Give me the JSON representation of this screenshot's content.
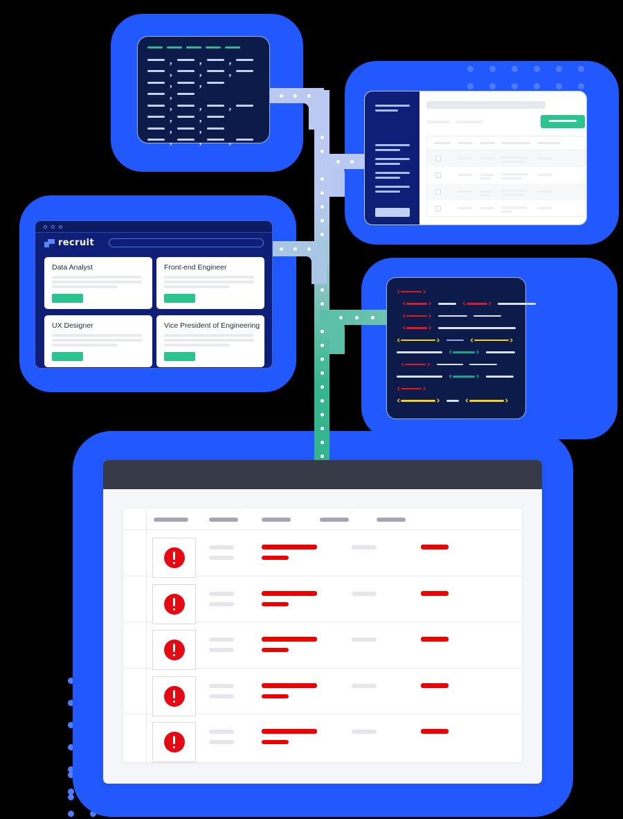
{
  "illustration": {
    "title": "Recruiting data pipeline illustration",
    "colors": {
      "plate_blue": "#2259ff",
      "dark_navy": "#0d1b4b",
      "sidebar_navy": "#0f1f78",
      "accent_green": "#2bc48f",
      "alert_red": "#e50914",
      "code_red": "#e01b24",
      "code_yellow": "#f2d024",
      "code_teal": "#17a98a",
      "pipe_light": "#b9c9f2",
      "pipe_green": "#35b58f",
      "titlebar_dark": "#373a47",
      "page_bg": "#000000"
    }
  },
  "csv_panel": {
    "name": "CSV data source",
    "header_segments": 5,
    "rows": [
      {
        "segments": 4
      },
      {
        "segments": 4
      },
      {
        "segments": 3
      },
      {
        "segments": 2
      },
      {
        "segments": 4
      },
      {
        "segments": 3
      },
      {
        "segments": 3
      },
      {
        "segments": 4
      }
    ],
    "separator": ","
  },
  "dashboard_panel": {
    "name": "ATS dashboard",
    "sidebar": {
      "brand_lines": 2,
      "nav_items": 5,
      "footer_chip": true
    },
    "main": {
      "page_title_placeholder": true,
      "filter_placeholders": 2,
      "primary_button": {
        "label": "",
        "color": "#2bc48f"
      },
      "table": {
        "column_count": 5,
        "row_count": 4,
        "has_checkboxes": true
      }
    }
  },
  "recruit_panel": {
    "name": "recruit job board",
    "window_dots": 3,
    "brand": "recruit",
    "search": {
      "placeholder": "",
      "value": ""
    },
    "jobs": [
      {
        "title": "Data Analyst",
        "desc_lines": 3,
        "action_label": ""
      },
      {
        "title": "Front-end Engineer",
        "desc_lines": 3,
        "action_label": ""
      },
      {
        "title": "UX Designer",
        "desc_lines": 3,
        "action_label": ""
      },
      {
        "title": "Vice President of Engineering",
        "desc_lines": 3,
        "action_label": ""
      }
    ]
  },
  "code_panel": {
    "name": "HTML markup source",
    "rows": [
      {
        "tokens": [
          {
            "type": "tag",
            "color": "red",
            "w": 30
          }
        ]
      },
      {
        "tokens": [
          {
            "type": "tag",
            "color": "red",
            "w": 30,
            "indent": 8
          },
          {
            "type": "text",
            "w": 26
          },
          {
            "type": "tag",
            "color": "red",
            "w": 30
          },
          {
            "type": "text",
            "w": 55
          }
        ]
      },
      {
        "tokens": [
          {
            "type": "tag",
            "color": "red",
            "w": 30,
            "indent": 8
          },
          {
            "type": "text",
            "w": 42
          },
          {
            "type": "text",
            "w": 40
          }
        ]
      },
      {
        "tokens": [
          {
            "type": "tag",
            "color": "red",
            "w": 30,
            "indent": 8
          },
          {
            "type": "text",
            "w": 112
          }
        ]
      },
      {
        "tokens": [
          {
            "type": "tag",
            "color": "yellow",
            "w": 50
          },
          {
            "type": "text",
            "w": 25,
            "tint": "blue"
          },
          {
            "type": "tag",
            "color": "yellow",
            "w": 50
          }
        ]
      },
      {
        "tokens": [
          {
            "type": "text",
            "w": 66
          },
          {
            "type": "tag",
            "color": "teal",
            "w": 32
          },
          {
            "type": "text",
            "w": 42
          }
        ]
      },
      {
        "tokens": [
          {
            "type": "tag",
            "color": "red",
            "w": 30,
            "indent": 6
          },
          {
            "type": "text",
            "w": 38
          },
          {
            "type": "text",
            "w": 40
          }
        ]
      },
      {
        "tokens": [
          {
            "type": "text",
            "w": 66
          },
          {
            "type": "tag",
            "color": "teal",
            "w": 32
          },
          {
            "type": "text",
            "w": 40
          }
        ]
      },
      {
        "tokens": [
          {
            "type": "tag",
            "color": "red",
            "w": 30
          }
        ]
      },
      {
        "tokens": [
          {
            "type": "tag",
            "color": "yellow",
            "w": 50
          },
          {
            "type": "text",
            "w": 18
          },
          {
            "type": "tag",
            "color": "yellow",
            "w": 50
          }
        ]
      }
    ]
  },
  "results_panel": {
    "name": "Validation results table",
    "titlebar": {
      "label": ""
    },
    "table": {
      "headers": [
        "",
        "",
        "",
        "",
        ""
      ],
      "header_widths": [
        50,
        42,
        42,
        42,
        42
      ],
      "rows": [
        {
          "status": "error",
          "status_icon": "alert-exclamation-icon",
          "cells": [
            {
              "type": "grey",
              "w": 36
            },
            {
              "type": "grey",
              "w": 36
            },
            {
              "type": "red",
              "w": 80
            },
            {
              "type": "red",
              "w": 39
            },
            {
              "type": "grey",
              "w": 36
            },
            {
              "type": "red",
              "w": 40
            }
          ]
        },
        {
          "status": "error",
          "status_icon": "alert-exclamation-icon",
          "cells": [
            {
              "type": "grey",
              "w": 36
            },
            {
              "type": "grey",
              "w": 36
            },
            {
              "type": "red",
              "w": 80
            },
            {
              "type": "red",
              "w": 39
            },
            {
              "type": "grey",
              "w": 36
            },
            {
              "type": "red",
              "w": 40
            }
          ]
        },
        {
          "status": "error",
          "status_icon": "alert-exclamation-icon",
          "cells": [
            {
              "type": "grey",
              "w": 36
            },
            {
              "type": "grey",
              "w": 36
            },
            {
              "type": "red",
              "w": 80
            },
            {
              "type": "red",
              "w": 39
            },
            {
              "type": "grey",
              "w": 36
            },
            {
              "type": "red",
              "w": 40
            }
          ]
        },
        {
          "status": "error",
          "status_icon": "alert-exclamation-icon",
          "cells": [
            {
              "type": "grey",
              "w": 36
            },
            {
              "type": "grey",
              "w": 36
            },
            {
              "type": "red",
              "w": 80
            },
            {
              "type": "red",
              "w": 39
            },
            {
              "type": "grey",
              "w": 36
            },
            {
              "type": "red",
              "w": 40
            }
          ]
        },
        {
          "status": "error",
          "status_icon": "alert-exclamation-icon",
          "cells": [
            {
              "type": "grey",
              "w": 36
            },
            {
              "type": "grey",
              "w": 36
            },
            {
              "type": "red",
              "w": 80
            },
            {
              "type": "red",
              "w": 39
            },
            {
              "type": "grey",
              "w": 36
            },
            {
              "type": "red",
              "w": 40
            }
          ]
        }
      ]
    }
  },
  "decor": {
    "dots_top_right": {
      "cols": 6,
      "rows": 2,
      "color": "#4f7dff"
    },
    "dots_bottom_left": {
      "color": "#4f7dff"
    }
  }
}
